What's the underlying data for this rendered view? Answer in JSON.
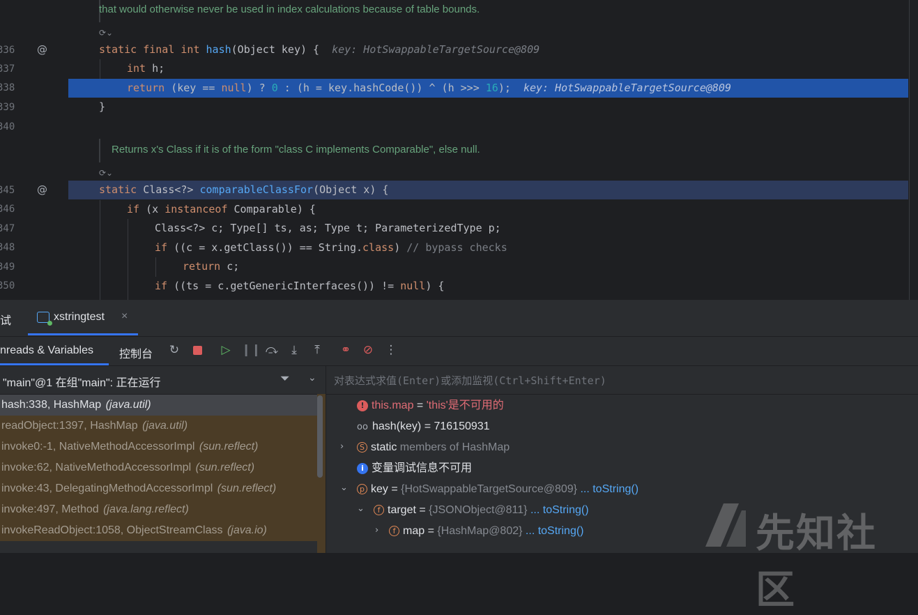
{
  "editor": {
    "doc_top": "that would otherwise never be used in index calculations because of table bounds.",
    "doc_mid": "Returns x's Class if it is of the form \"class C implements Comparable\", else null.",
    "lines": [
      {
        "num": "336",
        "anno": "@"
      },
      {
        "num": "337",
        "anno": ""
      },
      {
        "num": "338",
        "anno": ""
      },
      {
        "num": "339",
        "anno": ""
      },
      {
        "num": "340",
        "anno": ""
      },
      {
        "num": "345",
        "anno": "@"
      },
      {
        "num": "346",
        "anno": ""
      },
      {
        "num": "347",
        "anno": ""
      },
      {
        "num": "348",
        "anno": ""
      },
      {
        "num": "349",
        "anno": ""
      },
      {
        "num": "350",
        "anno": ""
      }
    ],
    "code": {
      "l336": {
        "kw": "static final int ",
        "fn": "hash",
        "rest": "(Object key) {",
        "hint": "key: HotSwappableTargetSource@809"
      },
      "l337": {
        "kw": "int",
        "rest": " h;"
      },
      "l338": {
        "kw": "return",
        "a": " (key == ",
        "null": "null",
        "b": ") ? ",
        "zero": "0",
        "c": " : (h = key.hashCode()) ^ (h >>> ",
        "sixteen": "16",
        "d": ");",
        "hint": "key: HotSwappableTargetSource@809"
      },
      "l339": {
        "rest": "}"
      },
      "l345": {
        "kw": "static ",
        "a": "Class<?> ",
        "fn": "comparableClassFor",
        "rest": "(Object x) {"
      },
      "l346": {
        "kw": "if",
        "a": " (x ",
        "kw2": "instanceof",
        "b": " Comparable) {"
      },
      "l347": {
        "rest": "Class<?> c; Type[] ts, as; Type t; ParameterizedType p;"
      },
      "l348": {
        "kw": "if",
        "a": " ((c = x.getClass()) == String.",
        "kw2": "class",
        "b": ") ",
        "cmt": "// bypass checks"
      },
      "l349": {
        "kw": "return",
        "rest": " c;"
      },
      "l350": {
        "kw": "if",
        "a": " ((ts = c.getGenericInterfaces()) != ",
        "null": "null",
        "b": ") {"
      }
    }
  },
  "debug": {
    "panel_title": "试",
    "session_tab": "xstringtest",
    "close_glyph": "×",
    "tab_threads": "nreads & Variables",
    "tab_console": "控制台",
    "thread_status": "\"main\"@1 在组\"main\": 正在运行",
    "eval_placeholder": "对表达式求值(Enter)或添加监视(Ctrl+Shift+Enter)",
    "frames": [
      {
        "name": "hash:338, HashMap ",
        "pkg": "(java.util)"
      },
      {
        "name": "readObject:1397, HashMap ",
        "pkg": "(java.util)"
      },
      {
        "name": "invoke0:-1, NativeMethodAccessorImpl ",
        "pkg": "(sun.reflect)"
      },
      {
        "name": "invoke:62, NativeMethodAccessorImpl ",
        "pkg": "(sun.reflect)"
      },
      {
        "name": "invoke:43, DelegatingMethodAccessorImpl ",
        "pkg": "(sun.reflect)"
      },
      {
        "name": "invoke:497, Method ",
        "pkg": "(java.lang.reflect)"
      },
      {
        "name": "invokeReadObject:1058, ObjectStreamClass ",
        "pkg": "(java.io)"
      }
    ],
    "variables": {
      "v1": {
        "name": "this.map",
        "eq": " = ",
        "value": "'this'是不可用的"
      },
      "v2": {
        "name": "hash(key)",
        "eq": " = ",
        "value": "716150931"
      },
      "v3": {
        "kw": "static",
        "rest": " members of HashMap"
      },
      "v4": {
        "text": "变量调试信息不可用"
      },
      "v5": {
        "name": "key",
        "eq": " = ",
        "value": "{HotSwappableTargetSource@809}",
        "link": "... toString()"
      },
      "v6": {
        "name": "target",
        "eq": " = ",
        "value": "{JSONObject@811}",
        "link": "... toString()"
      },
      "v7": {
        "name": "map",
        "eq": " = ",
        "value": "{HashMap@802}",
        "link": "... toString()"
      }
    }
  },
  "watermark": {
    "text": "先知社区"
  },
  "colors": {
    "exec_line": "#2154a8",
    "frame_bg": "#4b3c26",
    "accent": "#3574f0"
  }
}
